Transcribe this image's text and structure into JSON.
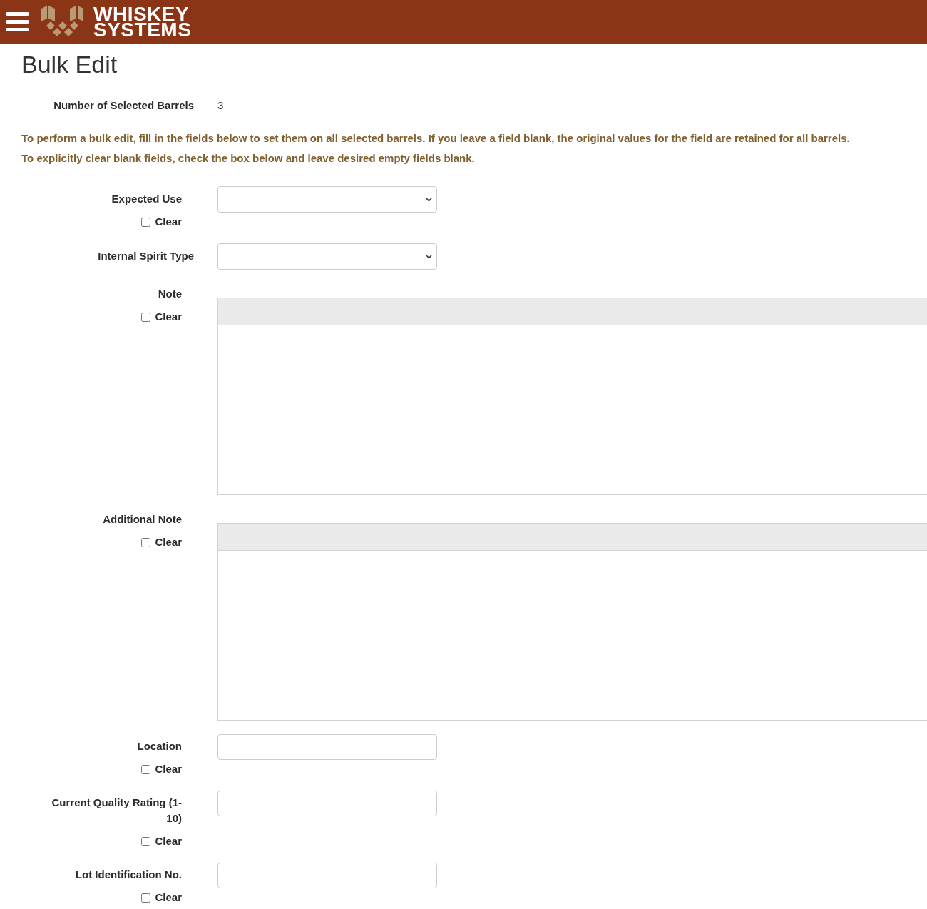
{
  "header": {
    "logo_text": [
      "WHISKEY",
      "SYSTEMS"
    ]
  },
  "page": {
    "title": "Bulk Edit"
  },
  "summary": {
    "label": "Number of Selected Barrels",
    "value": "3"
  },
  "instructions": [
    "To perform a bulk edit, fill in the fields below to set them on all selected barrels. If you leave a field blank, the original values for the field are retained for all barrels.",
    "To explicitly clear blank fields, check the box below and leave desired empty fields blank."
  ],
  "fields": [
    {
      "label": "Expected Use",
      "kind": "select",
      "clear": {
        "label": "Clear",
        "checked": false
      }
    },
    {
      "label": "Internal Spirit Type",
      "kind": "select"
    },
    {
      "label": "Note",
      "kind": "editor",
      "clear": {
        "label": "Clear",
        "checked": false
      }
    },
    {
      "label": "Additional Note",
      "kind": "editor",
      "clear": {
        "label": "Clear",
        "checked": false
      }
    },
    {
      "label": "Location",
      "kind": "text",
      "clear": {
        "label": "Clear",
        "checked": false
      }
    },
    {
      "label": "Current Quality Rating (1-10)",
      "kind": "text",
      "clear": {
        "label": "Clear",
        "checked": false
      }
    },
    {
      "label": "Lot Identification No.",
      "kind": "text",
      "clear": {
        "label": "Clear",
        "checked": false
      }
    }
  ]
}
